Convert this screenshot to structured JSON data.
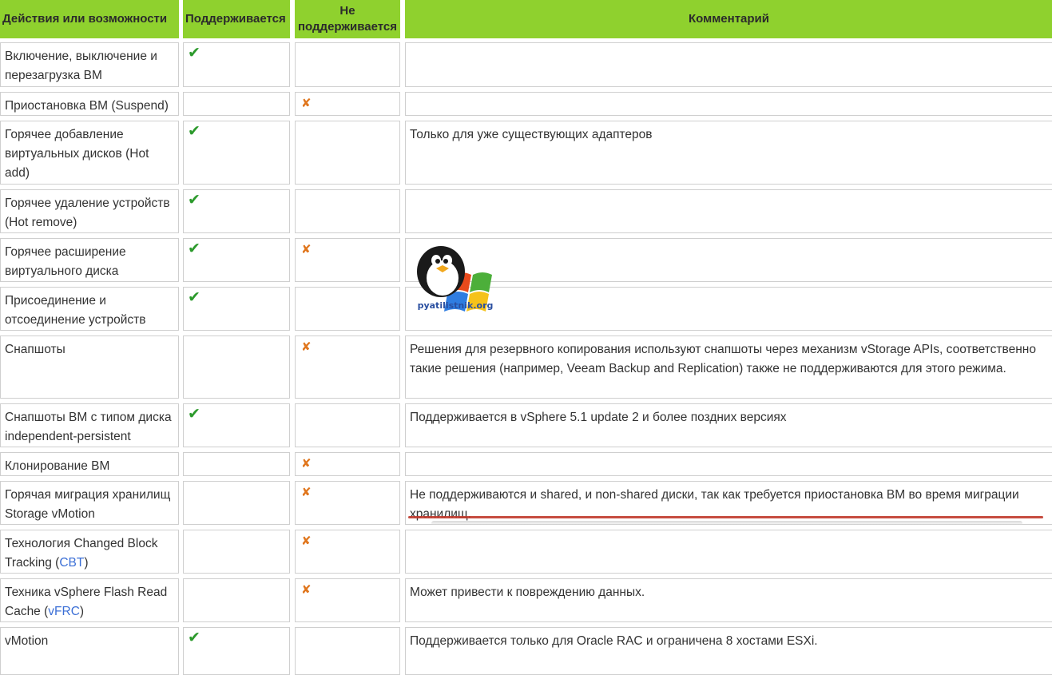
{
  "header": {
    "col1": "Действия или возможности",
    "col2": "Поддерживается",
    "col3_line1": "Не",
    "col3_line2": "поддерживается",
    "col4": "Комментарий"
  },
  "rows": [
    {
      "action": "Включение, выключение и перезагрузка ВМ",
      "supported": true,
      "not_supported": false,
      "comment": ""
    },
    {
      "action": "Приостановка ВМ (Suspend)",
      "supported": false,
      "not_supported": true,
      "comment": ""
    },
    {
      "action": "Горячее добавление виртуальных дисков (Hot add)",
      "supported": true,
      "not_supported": false,
      "comment": "Только для уже существующих адаптеров"
    },
    {
      "action": "Горячее удаление устройств (Hot remove)",
      "supported": true,
      "not_supported": false,
      "comment": ""
    },
    {
      "action": "Горячее расширение виртуального диска",
      "supported": true,
      "not_supported": true,
      "comment": ""
    },
    {
      "action": "Присоединение и отсоединение устройств",
      "supported": true,
      "not_supported": false,
      "comment": ""
    },
    {
      "action": "Снапшоты",
      "supported": false,
      "not_supported": true,
      "comment": "Решения для резервного копирования используют снапшоты через механизм vStorage APIs, соответственно такие решения (например, Veeam Backup and Replication) также не поддерживаются для этого режима."
    },
    {
      "action": "Снапшоты ВМ с типом диска independent-persistent",
      "supported": true,
      "not_supported": false,
      "comment": "Поддерживается в vSphere 5.1 update 2 и более поздних версиях"
    },
    {
      "action": "Клонирование ВМ",
      "supported": false,
      "not_supported": true,
      "comment": ""
    },
    {
      "action": "Горячая миграция хранилищ Storage vMotion",
      "supported": false,
      "not_supported": true,
      "comment": "Не поддерживаются и shared, и non-shared диски, так как требуется приостановка ВМ во время миграции хранилищ."
    },
    {
      "action": "Технология Changed Block Tracking (",
      "action_link": "CBT",
      "action_suffix": ")",
      "supported": false,
      "not_supported": true,
      "comment": ""
    },
    {
      "action": "Техника vSphere Flash Read Cache (",
      "action_link": "vFRC",
      "action_suffix": ")",
      "supported": false,
      "not_supported": true,
      "comment": "Может привести к повреждению данных."
    },
    {
      "action": "vMotion",
      "supported": true,
      "not_supported": false,
      "comment": "Поддерживается только для Oracle RAC и ограничена 8 хостами ESXi."
    }
  ],
  "marks": {
    "check": "✔",
    "cross": "✘",
    "check_color": "#2c9a2c",
    "cross_color": "#e0761d"
  },
  "watermark": {
    "text": "pyatilistnik.org"
  },
  "colors": {
    "header_bg": "#8fd12e",
    "link": "#3b6fd6",
    "underline": "#c0392b"
  }
}
